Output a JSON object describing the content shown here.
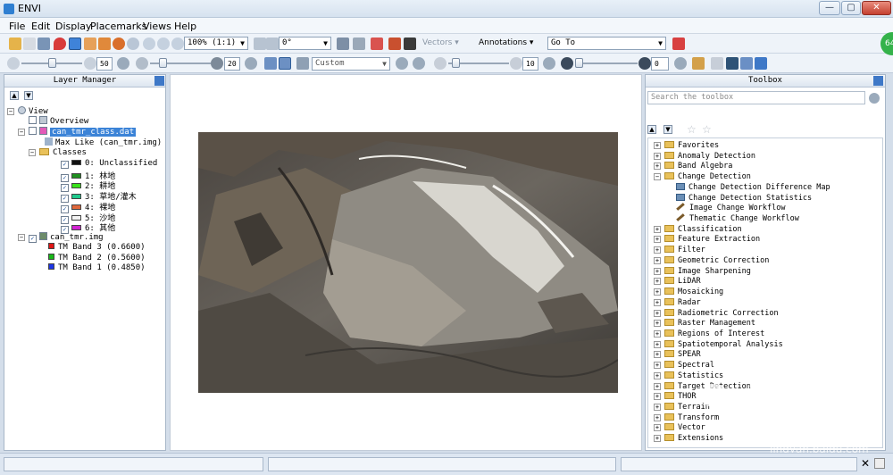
{
  "app": {
    "title": "ENVI"
  },
  "window_buttons": {
    "minimize": "—",
    "maximize": "▢",
    "close": "✕"
  },
  "menu": [
    "File",
    "Edit",
    "Display",
    "Placemarks",
    "Views",
    "Help"
  ],
  "toolbar": {
    "zoom_value": "100% (1:1)",
    "rotation_value": "0°",
    "vectors_label": "Vectors",
    "annotations_label": "Annotations",
    "goto_value": "Go To"
  },
  "toolbar2": {
    "brightness_value": "50",
    "contrast_value": "20",
    "stretch_value": "Custom",
    "sharpen_value": "10",
    "transparency_value": "0"
  },
  "layer_manager": {
    "title": "Layer Manager",
    "view_label": "View",
    "overview_label": "Overview",
    "class_file": "can_tmr_class.dat",
    "max_like": "Max Like (can_tmr.img)",
    "classes_label": "Classes",
    "classes": [
      {
        "label": "0: Unclassified",
        "color": "#111111"
      },
      {
        "label": "1: 林地",
        "color": "#1f8f1f"
      },
      {
        "label": "2: 耕地",
        "color": "#39e11a"
      },
      {
        "label": "3: 草地/灌木",
        "color": "#1fc98c"
      },
      {
        "label": "4: 裸地",
        "color": "#e0673b"
      },
      {
        "label": "5: 沙地",
        "color": "#f4f4f4"
      },
      {
        "label": "6: 其他",
        "color": "#d223d2"
      }
    ],
    "image_file": "can_tmr.img",
    "bands": [
      {
        "label": "TM Band 3 (0.6600)",
        "color": "#e01515"
      },
      {
        "label": "TM Band 2 (0.5600)",
        "color": "#18b818"
      },
      {
        "label": "TM Band 1 (0.4850)",
        "color": "#1d35e6"
      }
    ]
  },
  "toolbox": {
    "title": "Toolbox",
    "search_placeholder": "Search the toolbox",
    "items": [
      {
        "label": "Favorites",
        "kind": "folder-star",
        "expanded": false
      },
      {
        "label": "Anomaly Detection",
        "kind": "folder",
        "expanded": false
      },
      {
        "label": "Band Algebra",
        "kind": "folder",
        "expanded": false
      },
      {
        "label": "Change Detection",
        "kind": "folder",
        "expanded": true
      },
      {
        "label": "Change Detection Difference Map",
        "kind": "tool",
        "child": true
      },
      {
        "label": "Change Detection Statistics",
        "kind": "tool",
        "child": true
      },
      {
        "label": "Image Change Workflow",
        "kind": "wand",
        "child": true
      },
      {
        "label": "Thematic Change Workflow",
        "kind": "wand",
        "child": true
      },
      {
        "label": "Classification",
        "kind": "folder",
        "expanded": false
      },
      {
        "label": "Feature Extraction",
        "kind": "folder",
        "expanded": false
      },
      {
        "label": "Filter",
        "kind": "folder",
        "expanded": false
      },
      {
        "label": "Geometric Correction",
        "kind": "folder",
        "expanded": false
      },
      {
        "label": "Image Sharpening",
        "kind": "folder",
        "expanded": false
      },
      {
        "label": "LiDAR",
        "kind": "folder",
        "expanded": false
      },
      {
        "label": "Mosaicking",
        "kind": "folder",
        "expanded": false
      },
      {
        "label": "Radar",
        "kind": "folder",
        "expanded": false
      },
      {
        "label": "Radiometric Correction",
        "kind": "folder",
        "expanded": false
      },
      {
        "label": "Raster Management",
        "kind": "folder",
        "expanded": false
      },
      {
        "label": "Regions of Interest",
        "kind": "folder",
        "expanded": false
      },
      {
        "label": "Spatiotemporal Analysis",
        "kind": "folder",
        "expanded": false
      },
      {
        "label": "SPEAR",
        "kind": "folder",
        "expanded": false
      },
      {
        "label": "Spectral",
        "kind": "folder",
        "expanded": false
      },
      {
        "label": "Statistics",
        "kind": "folder",
        "expanded": false
      },
      {
        "label": "Target Detection",
        "kind": "folder",
        "expanded": false
      },
      {
        "label": "THOR",
        "kind": "folder",
        "expanded": false
      },
      {
        "label": "Terrain",
        "kind": "folder",
        "expanded": false
      },
      {
        "label": "Transform",
        "kind": "folder",
        "expanded": false
      },
      {
        "label": "Vector",
        "kind": "folder",
        "expanded": false
      },
      {
        "label": "Extensions",
        "kind": "folder",
        "expanded": false
      }
    ]
  },
  "watermark": {
    "brand": "Bai",
    "brand2": "du",
    "cn": "经验",
    "url": "jingyan.baidu.com"
  },
  "side_badge": "64"
}
